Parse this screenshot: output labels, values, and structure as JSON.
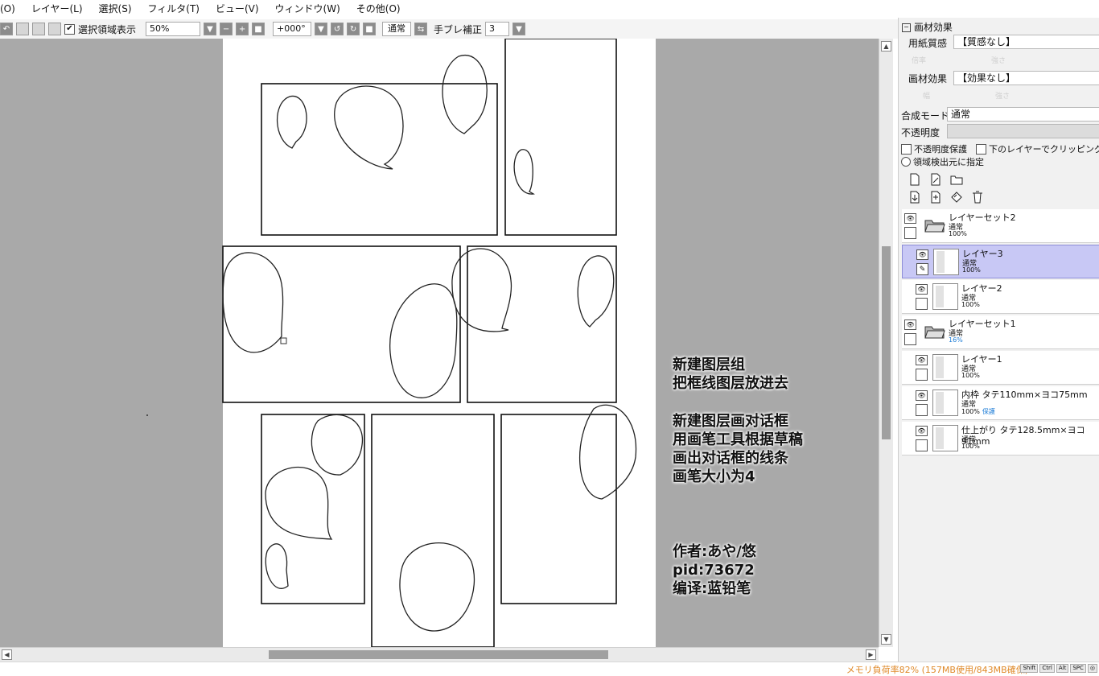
{
  "menu": [
    "(O)",
    "レイヤー(L)",
    "選択(S)",
    "フィルタ(T)",
    "ビュー(V)",
    "ウィンドウ(W)",
    "その他(O)"
  ],
  "toolbar": {
    "selection_display_label": "選択領域表示",
    "selection_display_checked": true,
    "zoom_value": "50%",
    "rotation_value": "+000°",
    "normal_button": "通常",
    "stabilizer_label": "手ブレ補正",
    "stabilizer_value": "3"
  },
  "right_panel": {
    "texture_header": "画材効果",
    "paper_texture_label": "用紙質感",
    "paper_texture_value": "【質感なし】",
    "effect_label": "画材効果",
    "effect_value": "【効果なし】",
    "blend_mode_label": "合成モード",
    "blend_mode_value": "通常",
    "opacity_label": "不透明度",
    "preserve_opacity_label": "不透明度保護",
    "clipping_label": "下のレイヤーでクリッピング",
    "selection_source_label": "領域検出元に指定"
  },
  "layers": [
    {
      "name": "レイヤーセット2",
      "blend": "通常",
      "opacity": "100%",
      "type": "folder",
      "indent": 0,
      "visible": true
    },
    {
      "name": "レイヤー3",
      "blend": "通常",
      "opacity": "100%",
      "type": "layer",
      "indent": 1,
      "visible": true,
      "selected": true,
      "editing": true
    },
    {
      "name": "レイヤー2",
      "blend": "通常",
      "opacity": "100%",
      "type": "layer",
      "indent": 1,
      "visible": true
    },
    {
      "name": "レイヤーセット1",
      "blend": "通常",
      "opacity": "16%",
      "type": "folder",
      "indent": 0,
      "visible": true
    },
    {
      "name": "レイヤー1",
      "blend": "通常",
      "opacity": "100%",
      "type": "layer",
      "indent": 1,
      "visible": true
    },
    {
      "name": "内枠 タテ110mm×ヨコ75mm",
      "blend": "通常",
      "opacity": "100%",
      "protected": "保護",
      "type": "layer",
      "indent": 1,
      "visible": true
    },
    {
      "name": "仕上がり タテ128.5mm×ヨコ91mm",
      "blend": "通常",
      "opacity": "100%",
      "type": "layer",
      "indent": 1,
      "visible": true
    }
  ],
  "annotations": {
    "block1": [
      "新建图层组",
      "把框线图层放进去"
    ],
    "block2": [
      "新建图层画对话框",
      "用画笔工具根据草稿",
      "画出对话框的线条",
      "画笔大小为4"
    ],
    "credits": [
      "作者:あや/悠",
      "pid:73672",
      "编译:蓝铅笔"
    ]
  },
  "status": {
    "memory": "メモリ負荷率82% (157MB使用/843MB確保)",
    "keys": [
      "Shift",
      "Ctrl",
      "Alt",
      "SPC",
      "◎"
    ]
  },
  "icons": {
    "new-layer": "new-layer-icon",
    "new-linework": "new-linework-layer-icon",
    "new-folder": "new-folder-icon",
    "transfer-down": "transfer-down-icon",
    "merge-down": "merge-down-icon",
    "clear": "clear-layer-icon",
    "delete": "trash-icon"
  }
}
